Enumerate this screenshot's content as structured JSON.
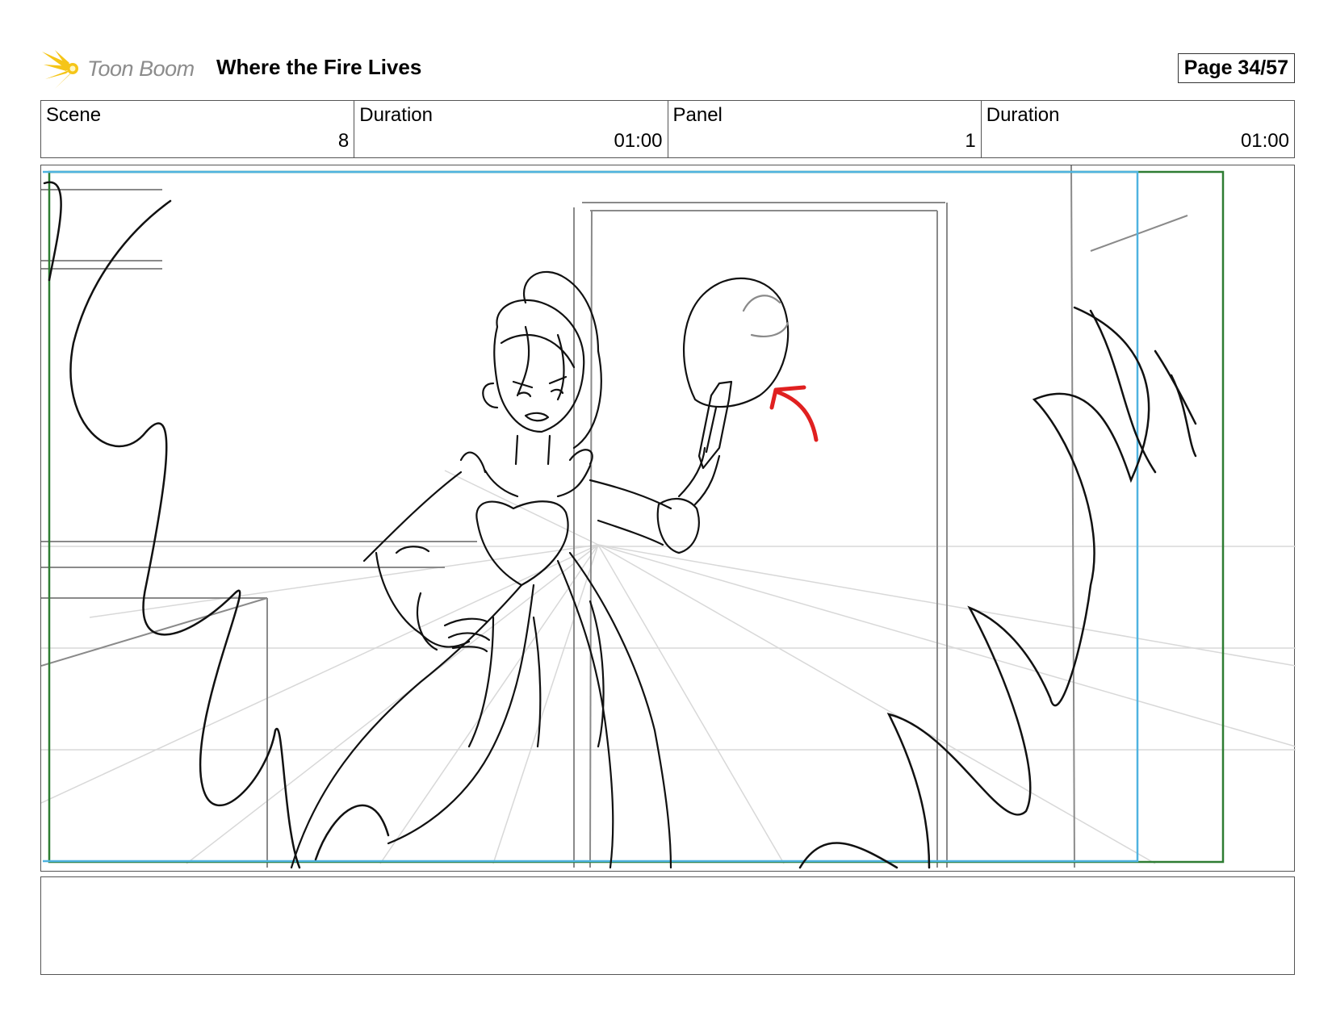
{
  "header": {
    "logo_text": "Toon Boom",
    "project_title": "Where the Fire Lives",
    "page_label": "Page 34/57"
  },
  "info": [
    {
      "label": "Scene",
      "value": "8"
    },
    {
      "label": "Duration",
      "value": "01:00"
    },
    {
      "label": "Panel",
      "value": "1"
    },
    {
      "label": "Duration",
      "value": "01:00"
    }
  ],
  "notes": {
    "text": ""
  },
  "colors": {
    "safe_frame": "#2e7d32",
    "camera_frame": "#4fb3e0",
    "annotation": "#e02020",
    "logo_yellow": "#f5c518"
  },
  "icons": {
    "logo": "toon-boom-burst-icon",
    "annotation": "red-arrow-icon"
  }
}
